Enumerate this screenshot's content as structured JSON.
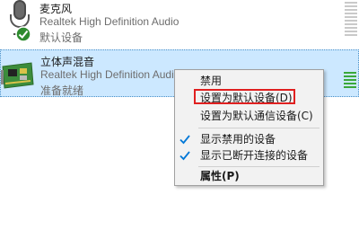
{
  "devices": [
    {
      "name": "麦克风",
      "driver": "Realtek High Definition Audio",
      "status": "默认设备",
      "icon": "microphone-icon",
      "badge": "default-check-icon"
    },
    {
      "name": "立体声混音",
      "driver": "Realtek High Definition Audio",
      "status": "准备就绪",
      "icon": "sound-card-icon"
    }
  ],
  "context_menu": {
    "items": [
      {
        "label": "禁用"
      },
      {
        "label": "设置为默认设备(D)",
        "highlighted": true
      },
      {
        "label": "设置为默认通信设备(C)"
      },
      {
        "label": "显示禁用的设备",
        "checked": true
      },
      {
        "label": "显示已断开连接的设备",
        "checked": true
      },
      {
        "label": "属性(P)",
        "bold": true
      }
    ]
  },
  "colors": {
    "selection_bg": "#cce8ff",
    "highlight_border": "#e02020",
    "check": "#0078d7",
    "meter_active": "#3aa83a"
  }
}
